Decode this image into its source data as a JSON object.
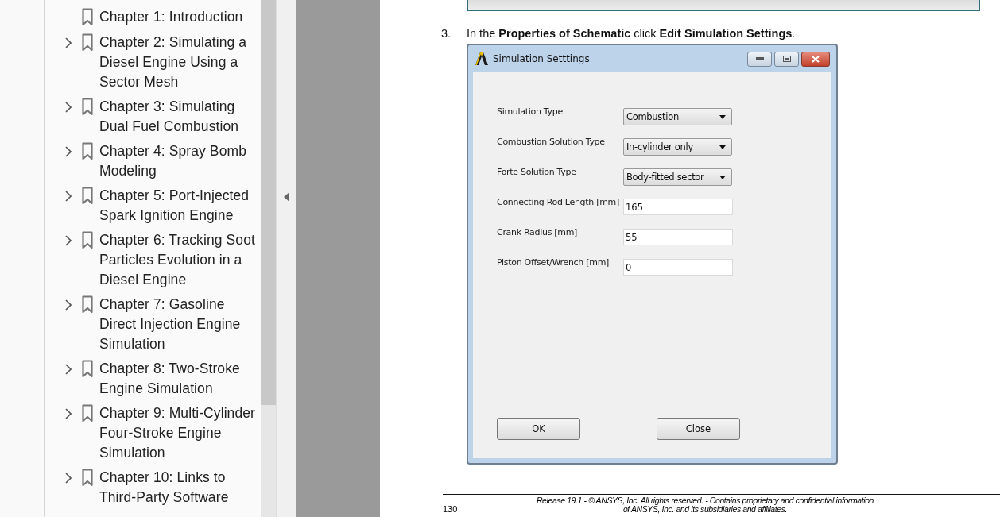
{
  "bookmarks": [
    {
      "title": "Chapter 1: Introduction",
      "expandable": false
    },
    {
      "title": "Chapter 2: Simulating a Diesel Engine Using a Sector Mesh",
      "expandable": true
    },
    {
      "title": "Chapter 3: Simulating Dual Fuel Combustion",
      "expandable": true
    },
    {
      "title": "Chapter 4: Spray Bomb Modeling",
      "expandable": true
    },
    {
      "title": "Chapter 5: Port-Injected Spark Ignition Engine",
      "expandable": true
    },
    {
      "title": "Chapter 6: Tracking Soot Particles Evolution in a Diesel Engine",
      "expandable": true
    },
    {
      "title": "Chapter 7: Gasoline Direct Injection Engine Simulation",
      "expandable": true
    },
    {
      "title": "Chapter 8: Two-Stroke Engine Simulation",
      "expandable": true
    },
    {
      "title": "Chapter 9: Multi-Cylinder Four-Stroke Engine Simulation",
      "expandable": true
    },
    {
      "title": "Chapter 10: Links to Third-Party Software",
      "expandable": true
    }
  ],
  "document": {
    "step": {
      "number": "3.",
      "text": "In the **Properties of Schematic** click **Edit Simulation Settings**."
    },
    "dialog": {
      "title": "Simulation Setttings",
      "fields": [
        {
          "kind": "dropdown",
          "label": "Simulation Type",
          "value": "Combustion"
        },
        {
          "kind": "dropdown",
          "label": "Combustion Solution Type",
          "value": "In-cylinder only"
        },
        {
          "kind": "dropdown",
          "label": "Forte Solution Type",
          "value": "Body-fitted sector"
        },
        {
          "kind": "text",
          "label": "Connecting Rod Length [mm]",
          "value": "165"
        },
        {
          "kind": "text",
          "label": "Crank Radius [mm]",
          "value": "55"
        },
        {
          "kind": "text",
          "label": "Piston Offset/Wrench [mm]",
          "value": "0"
        }
      ],
      "buttons": [
        "OK",
        "Close"
      ]
    },
    "footer": {
      "page_number": "130",
      "notice": [
        "Release 19.1 - © ANSYS, Inc. All rights reserved. - Contains proprietary and confidential information",
        "of ANSYS, Inc. and its subsidiaries and affiliates."
      ]
    }
  }
}
